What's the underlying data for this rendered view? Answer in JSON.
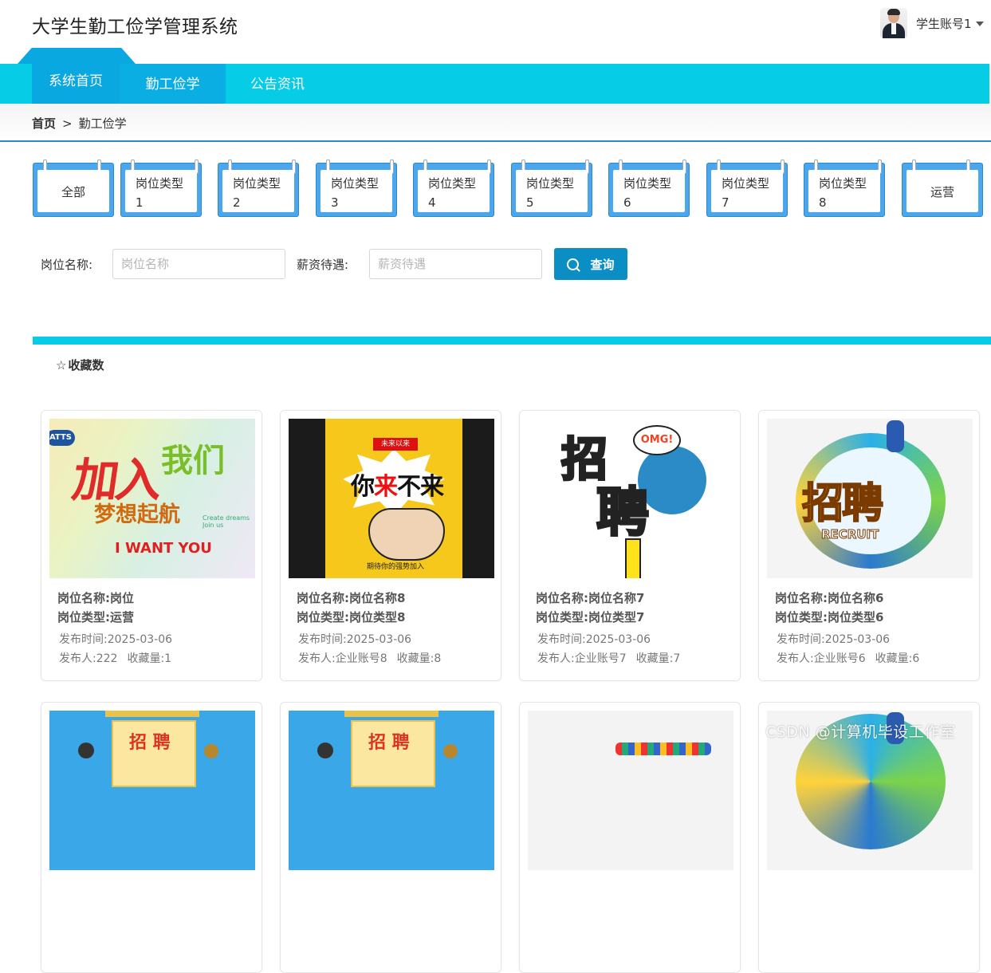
{
  "header": {
    "site_title": "大学生勤工俭学管理系统",
    "user_name": "学生账号1"
  },
  "nav": {
    "items": [
      {
        "label": "系统首页"
      },
      {
        "label": "勤工俭学"
      },
      {
        "label": "公告资讯"
      }
    ]
  },
  "breadcrumb": {
    "home": "首页",
    "separator": ">",
    "current": "勤工俭学"
  },
  "categories": [
    {
      "line1": "全部",
      "line2": ""
    },
    {
      "line1": "岗位类型",
      "line2": "1"
    },
    {
      "line1": "岗位类型",
      "line2": "2"
    },
    {
      "line1": "岗位类型",
      "line2": "3"
    },
    {
      "line1": "岗位类型",
      "line2": "4"
    },
    {
      "line1": "岗位类型",
      "line2": "5"
    },
    {
      "line1": "岗位类型",
      "line2": "6"
    },
    {
      "line1": "岗位类型",
      "line2": "7"
    },
    {
      "line1": "岗位类型",
      "line2": "8"
    },
    {
      "line1": "运营",
      "line2": ""
    }
  ],
  "search": {
    "name_label": "岗位名称:",
    "name_placeholder": "岗位名称",
    "name_value": "",
    "salary_label": "薪资待遇:",
    "salary_placeholder": "薪资待遇",
    "salary_value": "",
    "button_label": "查询"
  },
  "sort": {
    "star_icon": "☆",
    "label": "收藏数"
  },
  "cards": [
    {
      "name": "岗位名称:岗位",
      "type": "岗位类型:运营",
      "time": "发布时间:2025-03-06",
      "publisher": "发布人:222",
      "favs": "收藏量:1",
      "img_text": {
        "logo": "ATTS",
        "cn1": "加入",
        "cn2": "我们",
        "cn3": "梦想起航",
        "en": "I WANT YOU",
        "small1": "Create dreams",
        "small2": "Join us"
      }
    },
    {
      "name": "岗位名称:岗位名称8",
      "type": "岗位类型:岗位类型8",
      "time": "发布时间:2025-03-06",
      "publisher": "发布人:企业账号8",
      "favs": "收藏量:8",
      "img_text": {
        "tag": "未来以来",
        "big1": "你",
        "big2": "来",
        "big3": "不来",
        "foot": "期待你的强势加入"
      }
    },
    {
      "name": "岗位名称:岗位名称7",
      "type": "岗位类型:岗位类型7",
      "time": "发布时间:2025-03-06",
      "publisher": "发布人:企业账号7",
      "favs": "收藏量:7",
      "img_text": {
        "z1": "招",
        "z2": "聘",
        "omg": "OMG!"
      }
    },
    {
      "name": "岗位名称:岗位名称6",
      "type": "岗位类型:岗位类型6",
      "time": "发布时间:2025-03-06",
      "publisher": "发布人:企业账号6",
      "favs": "收藏量:6",
      "img_text": {
        "zp": "招聘",
        "rec": "RECRUIT"
      }
    },
    {
      "img_text": {
        "zp": "招 聘"
      }
    },
    {
      "img_text": {
        "zp": "招 聘"
      }
    },
    {
      "img_text": {}
    },
    {
      "img_text": {}
    }
  ],
  "watermark": "CSDN @计算机毕设工作室",
  "colors": {
    "nav_bg": "#07cce6",
    "nav_active": "#09a8e0",
    "button": "#0a8ec4",
    "category_frame": "#4aa7ee"
  }
}
